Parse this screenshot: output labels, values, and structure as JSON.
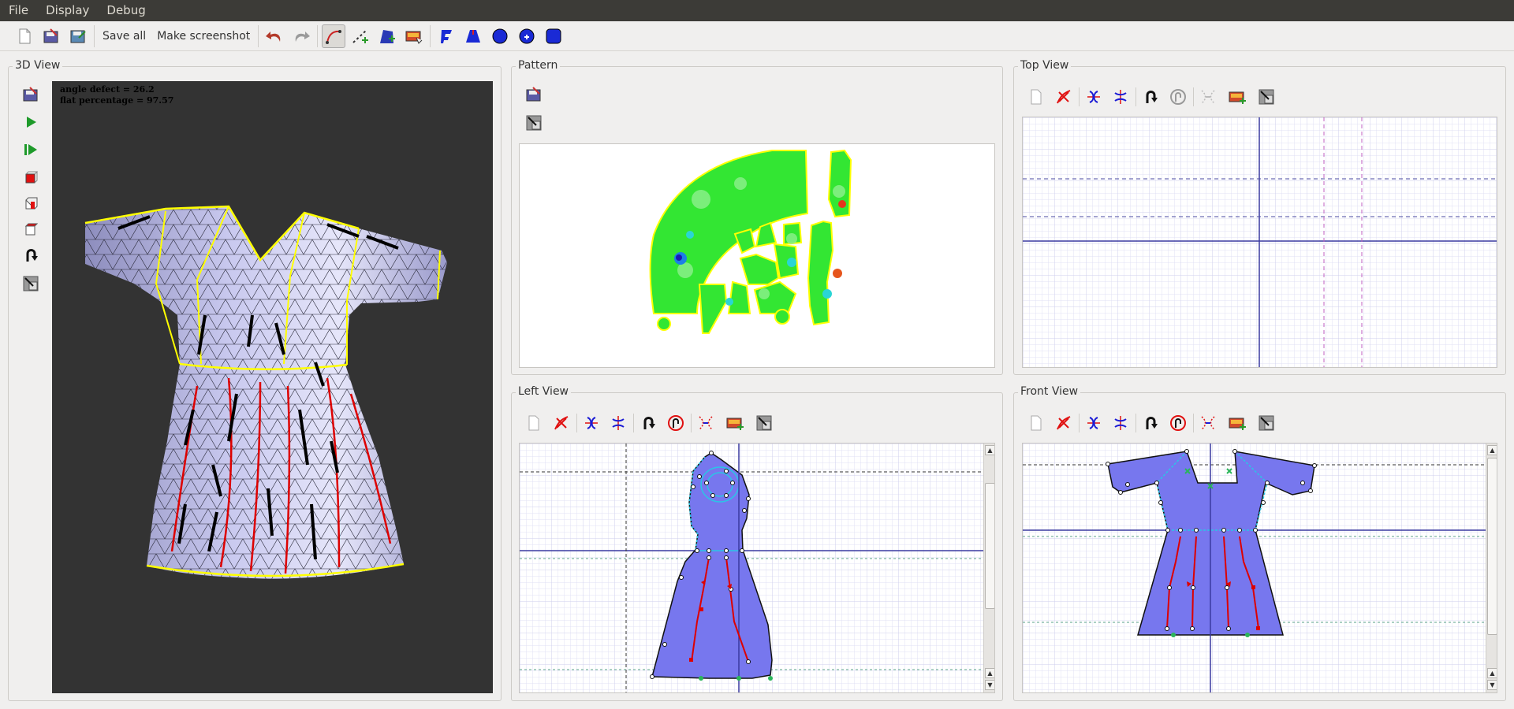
{
  "menu": [
    "File",
    "Display",
    "Debug"
  ],
  "toolbar": {
    "save_all": "Save all",
    "make_screenshot": "Make screenshot"
  },
  "panels": {
    "view3d": {
      "title": "3D View",
      "angle_defect": "angle defect = 26.2",
      "flat_percentage": "flat percentage = 97.57"
    },
    "pattern": {
      "title": "Pattern"
    },
    "top": {
      "title": "Top View"
    },
    "left": {
      "title": "Left View"
    },
    "front": {
      "title": "Front View"
    }
  },
  "colors": {
    "mesh": "#b9b9e6",
    "seam": "#ffff00",
    "stroke_red": "#dd0000",
    "sketch_fill": "#7777ee",
    "pattern_green": "#33e633",
    "grid": "#dcdcf2",
    "axis": "#3a3aa0"
  }
}
